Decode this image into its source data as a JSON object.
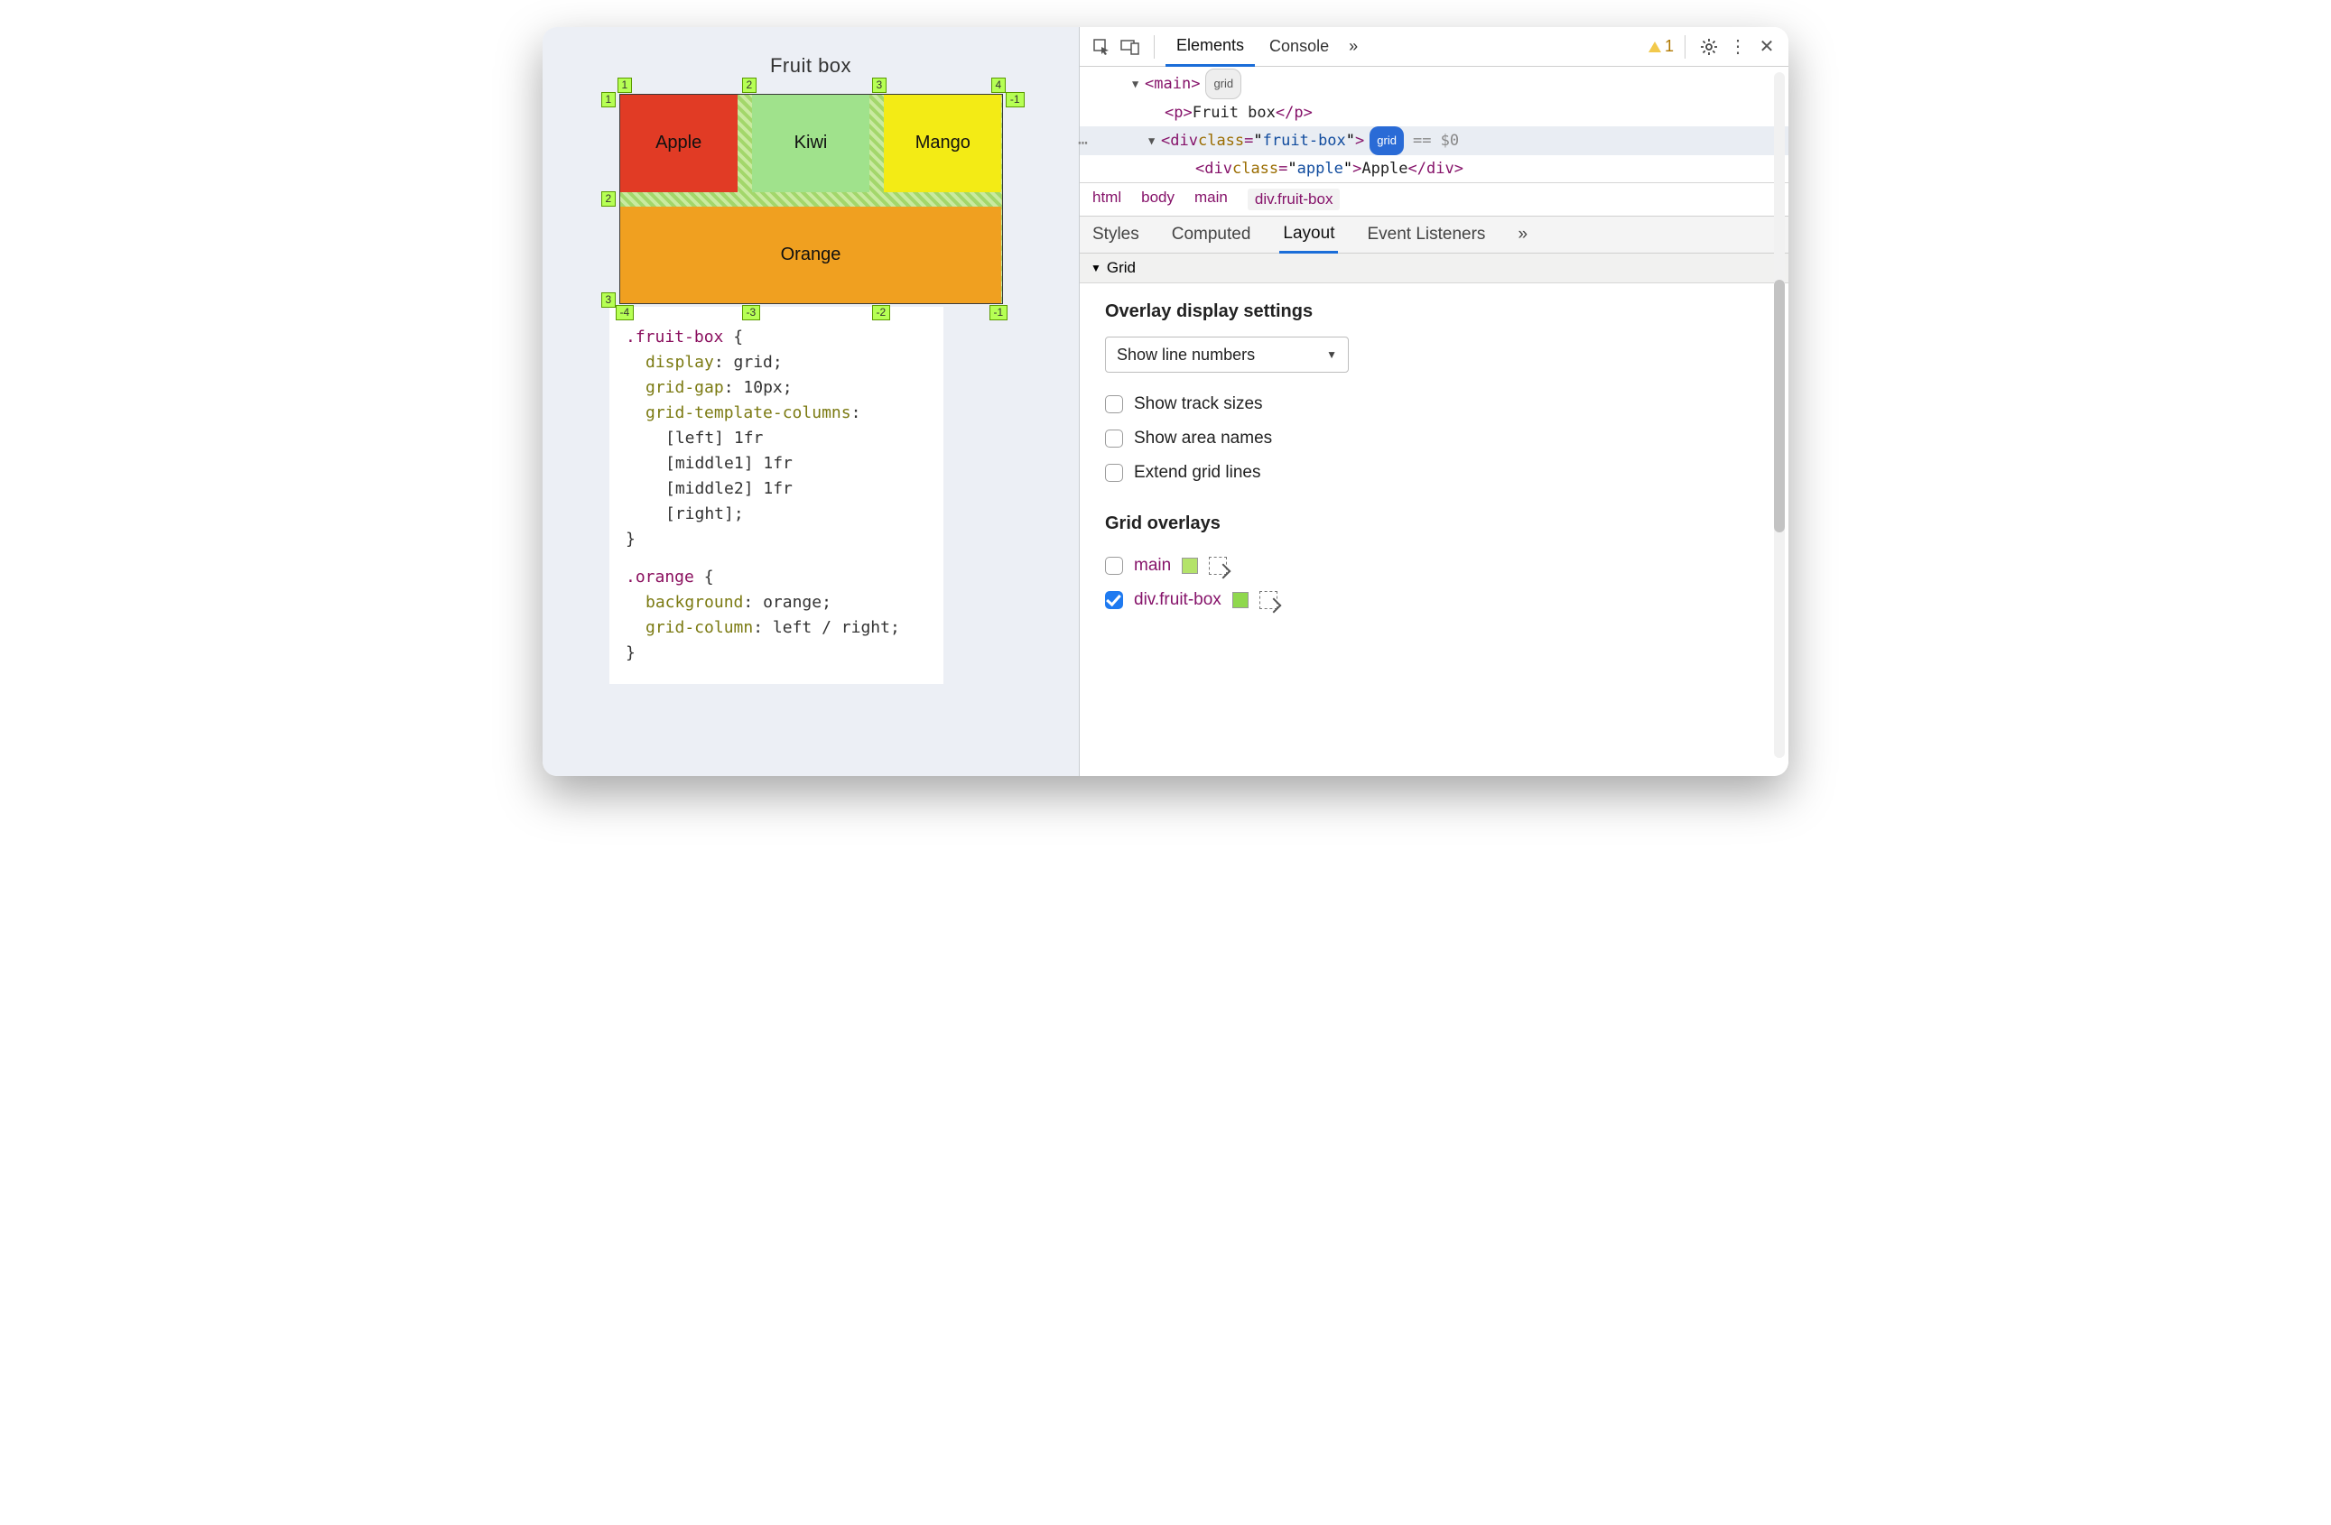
{
  "preview": {
    "title": "Fruit box",
    "cells": {
      "apple": "Apple",
      "kiwi": "Kiwi",
      "mango": "Mango",
      "orange": "Orange"
    },
    "line_numbers": {
      "top": [
        "1",
        "2",
        "3",
        "4"
      ],
      "bottom": [
        "-4",
        "-3",
        "-2",
        "-1"
      ],
      "left": [
        "1",
        "2",
        "3"
      ],
      "right": [
        "-1"
      ]
    },
    "css": {
      "rule1_selector": ".fruit-box",
      "rule1": [
        {
          "prop": "display",
          "val": "grid"
        },
        {
          "prop": "grid-gap",
          "val": "10px"
        },
        {
          "prop": "grid-template-columns",
          "val_lines": [
            "[left] 1fr",
            "[middle1] 1fr",
            "[middle2] 1fr",
            "[right]"
          ]
        }
      ],
      "rule2_selector": ".orange",
      "rule2": [
        {
          "prop": "background",
          "val": "orange"
        },
        {
          "prop": "grid-column",
          "val": "left / right"
        }
      ]
    }
  },
  "toolbar": {
    "tabs": {
      "elements": "Elements",
      "console": "Console"
    },
    "overflow": "»",
    "warning_count": "1"
  },
  "dom": {
    "row_main_open": "main",
    "row_main_badge": "grid",
    "row_p_text": "Fruit box",
    "row_div_class": "fruit-box",
    "row_div_badge": "grid",
    "row_div_eq": "== $0",
    "row_apple_class": "apple",
    "row_apple_text": "Apple"
  },
  "crumbs": [
    "html",
    "body",
    "main",
    "div.fruit-box"
  ],
  "subtabs": {
    "styles": "Styles",
    "computed": "Computed",
    "layout": "Layout",
    "event": "Event Listeners",
    "overflow": "»"
  },
  "grid_panel": {
    "header": "Grid",
    "overlay_heading": "Overlay display settings",
    "select_value": "Show line numbers",
    "options": {
      "track_sizes": "Show track sizes",
      "area_names": "Show area names",
      "extend_lines": "Extend grid lines"
    },
    "overlays_heading": "Grid overlays",
    "overlays": [
      {
        "label": "main",
        "checked": false,
        "swatch": "#b4e36a"
      },
      {
        "label": "div.fruit-box",
        "checked": true,
        "swatch": "#8fd84d"
      }
    ]
  }
}
